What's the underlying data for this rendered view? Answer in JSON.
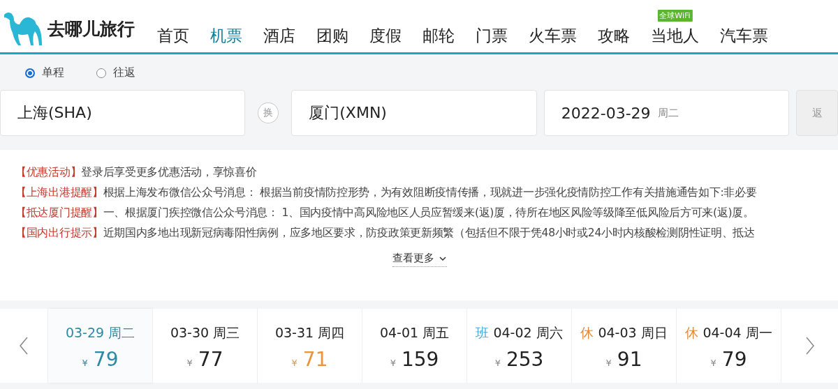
{
  "header": {
    "brand": "去哪儿旅行",
    "nav": [
      {
        "label": "首页",
        "selected": false
      },
      {
        "label": "机票",
        "selected": true
      },
      {
        "label": "酒店",
        "selected": false
      },
      {
        "label": "团购",
        "selected": false
      },
      {
        "label": "度假",
        "selected": false
      },
      {
        "label": "邮轮",
        "selected": false
      },
      {
        "label": "门票",
        "selected": false
      },
      {
        "label": "火车票",
        "selected": false
      },
      {
        "label": "攻略",
        "selected": false
      },
      {
        "label": "当地人",
        "selected": false,
        "badge": "全球WiFi"
      },
      {
        "label": "汽车票",
        "selected": false
      }
    ]
  },
  "trip_type": [
    {
      "label": "单程",
      "selected": true
    },
    {
      "label": "往返",
      "selected": false
    }
  ],
  "search": {
    "from": "上海(SHA)",
    "swap": "换",
    "to": "厦门(XMN)",
    "date": "2022-03-29",
    "weekday": "周二",
    "return": "返"
  },
  "notices": [
    {
      "tag": "【优惠活动】",
      "text": "登录后享受更多优惠活动，享惊喜价"
    },
    {
      "tag": "【上海出港提醒】",
      "text": "根据上海发布微信公众号消息： 根据当前疫情防控形势，为有效阻断疫情传播，现就进一步强化疫情防控工作有关措施通告如下:非必要"
    },
    {
      "tag": "【抵达厦门提醒】",
      "text": "一、根据厦门疾控微信公众号消息： 1、国内疫情中高风险地区人员应暂缓来(返)厦，待所在地区风险等级降至低风险后方可来(返)厦。"
    },
    {
      "tag": "【国内出行提示】",
      "text": "近期国内多地出现新冠病毒阳性病例，应多地区要求，防疫政策更新频繁（包括但不限于凭48小时或24小时内核酸检测阴性证明、抵达"
    }
  ],
  "more": "查看更多",
  "dates": [
    {
      "date": "03-29 周二",
      "currency": "¥",
      "price": "79",
      "selected": true,
      "lowest": false
    },
    {
      "date": "03-30 周三",
      "currency": "¥",
      "price": "77",
      "selected": false,
      "lowest": false
    },
    {
      "date": "03-31 周四",
      "currency": "¥",
      "price": "71",
      "selected": false,
      "lowest": true
    },
    {
      "date": "04-01 周五",
      "currency": "¥",
      "price": "159",
      "selected": false,
      "lowest": false
    },
    {
      "tag": "班",
      "kind": "work",
      "date": "04-02 周六",
      "currency": "¥",
      "price": "253",
      "selected": false,
      "lowest": false
    },
    {
      "tag": "休",
      "kind": "holiday",
      "date": "04-03 周日",
      "currency": "¥",
      "price": "91",
      "selected": false,
      "lowest": false
    },
    {
      "tag": "休",
      "kind": "holiday",
      "date": "04-04 周一",
      "currency": "¥",
      "price": "79",
      "selected": false,
      "lowest": false
    }
  ]
}
